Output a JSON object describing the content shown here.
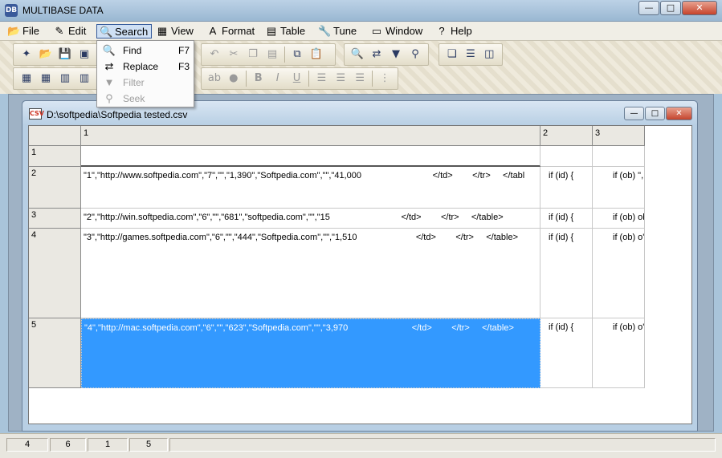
{
  "app": {
    "title": "MULTIBASE DATA"
  },
  "window_buttons": {
    "minimize": "—",
    "maximize": "□",
    "close": "✕"
  },
  "menu": {
    "file": "File",
    "edit": "Edit",
    "search": "Search",
    "view": "View",
    "format": "Format",
    "table": "Table",
    "tune": "Tune",
    "window": "Window",
    "help": "Help"
  },
  "search_menu": {
    "find": {
      "label": "Find",
      "key": "F7"
    },
    "replace": {
      "label": "Replace",
      "key": "F3"
    },
    "filter": {
      "label": "Filter"
    },
    "seek": {
      "label": "Seek"
    }
  },
  "toolbar": {
    "row1": [
      "new-icon",
      "open-icon",
      "save-icon",
      "print-icon",
      "undo-icon",
      "cut-icon",
      "copy-icon",
      "paste-icon",
      "copy2-icon",
      "paste2-icon",
      "find-icon",
      "replace-icon",
      "filter-icon",
      "seek-icon",
      "cascade-icon",
      "tile-horizontal-icon",
      "tile-vertical-icon"
    ],
    "row2": [
      "grid1-icon",
      "grid2-icon",
      "grid3-icon",
      "grid4-icon",
      "filter-icon",
      "spell-icon",
      "color-icon",
      "bold-icon",
      "italic-icon",
      "underline-icon",
      "align-left-icon",
      "align-center-icon",
      "align-right-icon",
      "list-icon"
    ]
  },
  "document": {
    "title": "D:\\softpedia\\Softpedia tested.csv"
  },
  "grid": {
    "columns": [
      "1",
      "2",
      "3"
    ],
    "rows": [
      {
        "num": "1",
        "c1": "",
        "c2": "",
        "c3": ""
      },
      {
        "num": "2",
        "c1": "\"1\",\"http://www.softpedia.com\",\"7\",\"\",\"1,390\",\"Softpedia.com\",\"\",\"41,000                             </td>        </tr>     </tabl",
        "c2": "if (id) {",
        "c3": "if (ob) \","
      },
      {
        "num": "3",
        "c1": "\"2\",\"http://win.softpedia.com\",\"6\",\"\",\"681\",\"softpedia.com\",\"\",\"15                             </td>        </tr>     </table>",
        "c2": "if (id) {",
        "c3": "if (ob) ob"
      },
      {
        "num": "4",
        "c1": "\"3\",\"http://games.softpedia.com\",\"6\",\"\",\"444\",\"Softpedia.com\",\"\",\"1,510                        </td>        </tr>     </table>",
        "c2": "if (id) {",
        "c3": "if (ob) o'"
      },
      {
        "num": "5",
        "c1": "\"4\",\"http://mac.softpedia.com\",\"6\",\"\",\"623\",\"Softpedia.com\",\"\",\"3,970                          </td>        </tr>     </table>",
        "c2": "if (id) {",
        "c3": "if (ob) o'"
      }
    ]
  },
  "status": {
    "s1": "4",
    "s2": "6",
    "s3": "1",
    "s4": "5"
  },
  "colors": {
    "selection": "#3399ff",
    "menu_active": "#cfe0f4"
  }
}
